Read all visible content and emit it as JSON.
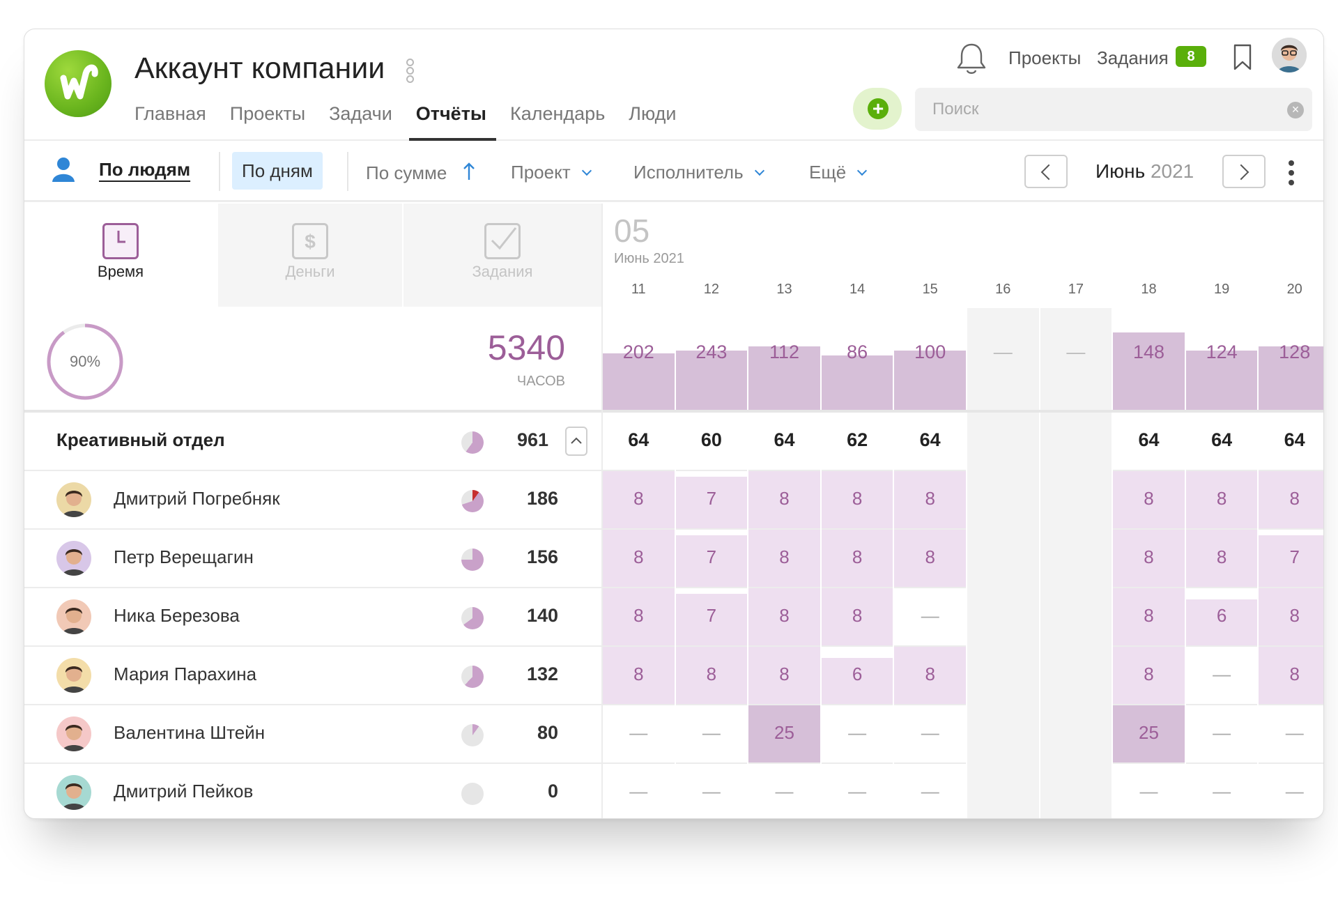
{
  "header": {
    "title": "Аккаунт компании",
    "logo_letter": "w",
    "nav": [
      "Главная",
      "Проекты",
      "Задачи",
      "Отчёты",
      "Календарь",
      "Люди"
    ],
    "active_nav": "Отчёты",
    "top_links": {
      "projects": "Проекты",
      "tasks": "Задания",
      "tasks_badge": "8"
    },
    "search_placeholder": "Поиск",
    "accent_color": "#5aaf0b"
  },
  "toolbar": {
    "by_people": "По людям",
    "by_days": "По дням",
    "sort": "По сумме",
    "project": "Проект",
    "assignee": "Исполнитель",
    "more": "Ещё",
    "month": "Июнь",
    "year": "2021"
  },
  "modes": [
    {
      "label": "Время",
      "icon": "clock-icon",
      "active": true
    },
    {
      "label": "Деньги",
      "icon": "dollar-icon",
      "active": false
    },
    {
      "label": "Задания",
      "icon": "check-icon",
      "active": false
    }
  ],
  "summary": {
    "progress": "90%",
    "progress_value": 0.9,
    "total": "5340",
    "unit": "ЧАСОВ"
  },
  "calendar": {
    "week": "05",
    "month_label": "Июнь 2021",
    "days": [
      "11",
      "12",
      "13",
      "14",
      "15",
      "16",
      "17",
      "18",
      "19",
      "20"
    ],
    "weekend": [
      false,
      false,
      false,
      false,
      false,
      true,
      true,
      false,
      false,
      false
    ],
    "day_totals": [
      "202",
      "243",
      "112",
      "86",
      "100",
      "—",
      "—",
      "148",
      "124",
      "128"
    ],
    "bar_levels": [
      0.56,
      0.59,
      0.63,
      0.54,
      0.59,
      0,
      0,
      0.77,
      0.59,
      0.63
    ],
    "bar_color": "#d6bfd8",
    "cell_color": "#eedff0",
    "text_color": "#9c5e98"
  },
  "group": {
    "name": "Креативный отдел",
    "total": "961",
    "pie": 0.6,
    "day_values": [
      "64",
      "60",
      "64",
      "62",
      "64",
      "",
      "",
      "64",
      "64",
      "64"
    ]
  },
  "people": [
    {
      "name": "Дмитрий Погребняк",
      "total": "186",
      "pie": 0.7,
      "pie_alert": true,
      "avatar_bg": "#ecd9a6",
      "values": [
        "8",
        "7",
        "8",
        "8",
        "8",
        "",
        "",
        "8",
        "8",
        "8"
      ],
      "fill": [
        1,
        0.9,
        1,
        1,
        1,
        0,
        0,
        1,
        1,
        1
      ]
    },
    {
      "name": "Петр Верещагин",
      "total": "156",
      "pie": 0.75,
      "pie_alert": false,
      "avatar_bg": "#d8c7e8",
      "values": [
        "8",
        "7",
        "8",
        "8",
        "8",
        "",
        "",
        "8",
        "8",
        "7"
      ],
      "fill": [
        1,
        0.9,
        1,
        1,
        1,
        0,
        0,
        1,
        1,
        0.9
      ]
    },
    {
      "name": "Ника Березова",
      "total": "140",
      "pie": 0.65,
      "pie_alert": false,
      "avatar_bg": "#f1c9b6",
      "values": [
        "8",
        "7",
        "8",
        "8",
        "—",
        "",
        "",
        "8",
        "6",
        "8"
      ],
      "fill": [
        1,
        0.9,
        1,
        1,
        0,
        0,
        0,
        1,
        0.8,
        1
      ]
    },
    {
      "name": "Мария Парахина",
      "total": "132",
      "pie": 0.62,
      "pie_alert": false,
      "avatar_bg": "#f3dda9",
      "values": [
        "8",
        "8",
        "8",
        "6",
        "8",
        "",
        "",
        "8",
        "—",
        "8"
      ],
      "fill": [
        1,
        1,
        1,
        0.8,
        1,
        0,
        0,
        1,
        0,
        1
      ]
    },
    {
      "name": "Валентина Штейн",
      "total": "80",
      "pie": 0.1,
      "pie_alert": false,
      "avatar_bg": "#f5c8c8",
      "values": [
        "—",
        "—",
        "25",
        "—",
        "—",
        "",
        "",
        "25",
        "—",
        "—"
      ],
      "fill": [
        0,
        0,
        1,
        0,
        0,
        0,
        0,
        1,
        0,
        0
      ]
    },
    {
      "name": "Дмитрий Пейков",
      "total": "0",
      "pie": 0,
      "pie_alert": false,
      "avatar_bg": "#a6d9d2",
      "values": [
        "—",
        "—",
        "—",
        "—",
        "—",
        "",
        "",
        "—",
        "—",
        "—"
      ],
      "fill": [
        0,
        0,
        0,
        0,
        0,
        0,
        0,
        0,
        0,
        0
      ]
    }
  ]
}
